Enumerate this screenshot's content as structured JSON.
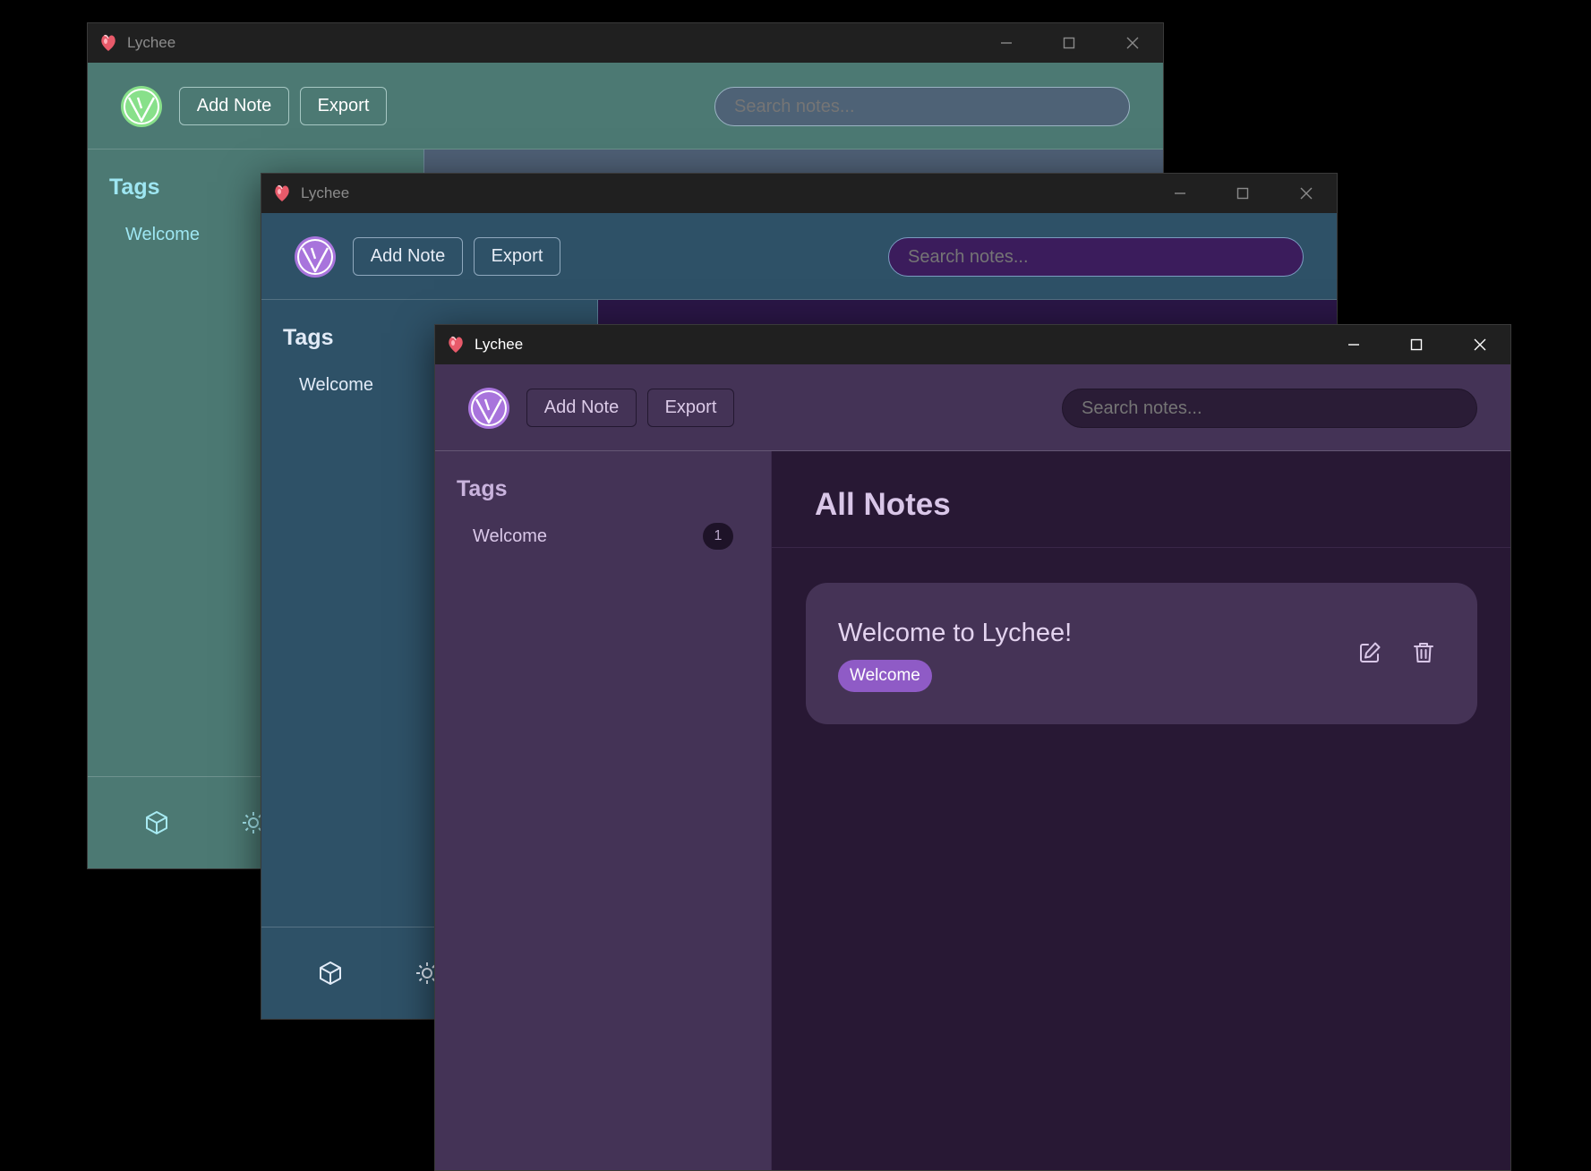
{
  "app": {
    "title": "Lychee"
  },
  "windows": [
    {
      "id": "win-teal",
      "theme": "teal",
      "header": {
        "add_note_label": "Add Note",
        "export_label": "Export",
        "search_placeholder": "Search notes..."
      },
      "sidebar": {
        "title": "Tags",
        "items": [
          {
            "label": "Welcome"
          }
        ]
      }
    },
    {
      "id": "win-blue",
      "theme": "blue",
      "header": {
        "add_note_label": "Add Note",
        "export_label": "Export",
        "search_placeholder": "Search notes..."
      },
      "sidebar": {
        "title": "Tags",
        "items": [
          {
            "label": "Welcome"
          }
        ]
      }
    },
    {
      "id": "win-purple",
      "theme": "purple",
      "active": true,
      "header": {
        "add_note_label": "Add Note",
        "export_label": "Export",
        "search_placeholder": "Search notes..."
      },
      "sidebar": {
        "title": "Tags",
        "items": [
          {
            "label": "Welcome",
            "count": "1"
          }
        ]
      },
      "main": {
        "title": "All Notes",
        "notes": [
          {
            "title": "Welcome to Lychee!",
            "tags": [
              "Welcome"
            ]
          }
        ]
      }
    }
  ],
  "icons": {
    "app": "lychee-app-icon",
    "logo": "v-logo-icon",
    "minimize": "minimize-icon",
    "maximize": "maximize-icon",
    "close": "close-icon",
    "cube": "cube-icon",
    "theme": "sun-icon",
    "edit": "edit-icon",
    "delete": "trash-icon"
  },
  "themes": {
    "teal": {
      "header": "#4c7973",
      "body": "#4c7973",
      "accent": "#9ee6f2",
      "logo": "#88e08a",
      "search_bg": "#4e6276"
    },
    "blue": {
      "header": "#2e5167",
      "body": "#2e5167",
      "accent": "#dae4f4",
      "logo": "#a874dc",
      "search_bg": "#3b1c5c"
    },
    "purple": {
      "header": "#443356",
      "body": "#443356",
      "accent": "#d5c5e6",
      "logo": "#a874dc",
      "search_bg": "#2a1c36",
      "main_bg": "#281834",
      "tag_bg": "#8f5bc6"
    }
  }
}
